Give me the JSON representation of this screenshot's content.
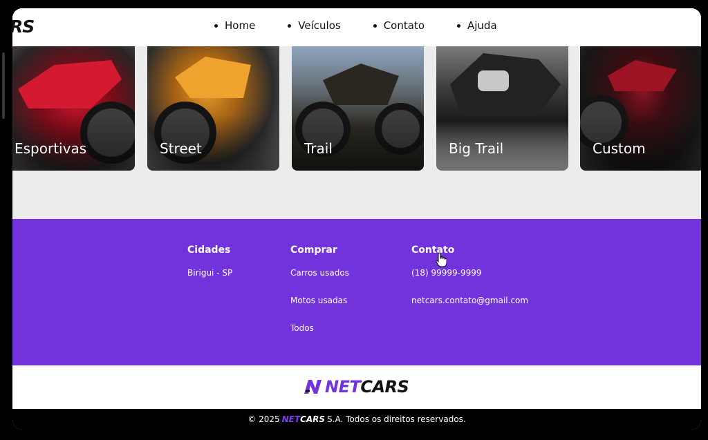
{
  "header": {
    "logo_fragment": "RS",
    "nav": [
      "Home",
      "Veículos",
      "Contato",
      "Ajuda"
    ]
  },
  "categories": [
    "Esportivas",
    "Street",
    "Trail",
    "Big Trail",
    "Custom"
  ],
  "footer": {
    "cidades": {
      "title": "Cidades",
      "items": [
        "Birigui - SP"
      ]
    },
    "comprar": {
      "title": "Comprar",
      "items": [
        "Carros usados",
        "Motos usadas",
        "Todos"
      ]
    },
    "contato": {
      "title": "Contato",
      "items": [
        "(18) 99999-9999",
        "netcars.contato@gmail.com"
      ]
    }
  },
  "brand": {
    "part1": "NET",
    "part2": "CARS"
  },
  "copyright": {
    "prefix": "© 2025",
    "brand1": "NET",
    "brand2": "CARS",
    "suffix": "S.A. Todos os direitos reservados."
  },
  "colors": {
    "accent": "#7233dd",
    "background": "#ececec",
    "dark": "#000000"
  }
}
